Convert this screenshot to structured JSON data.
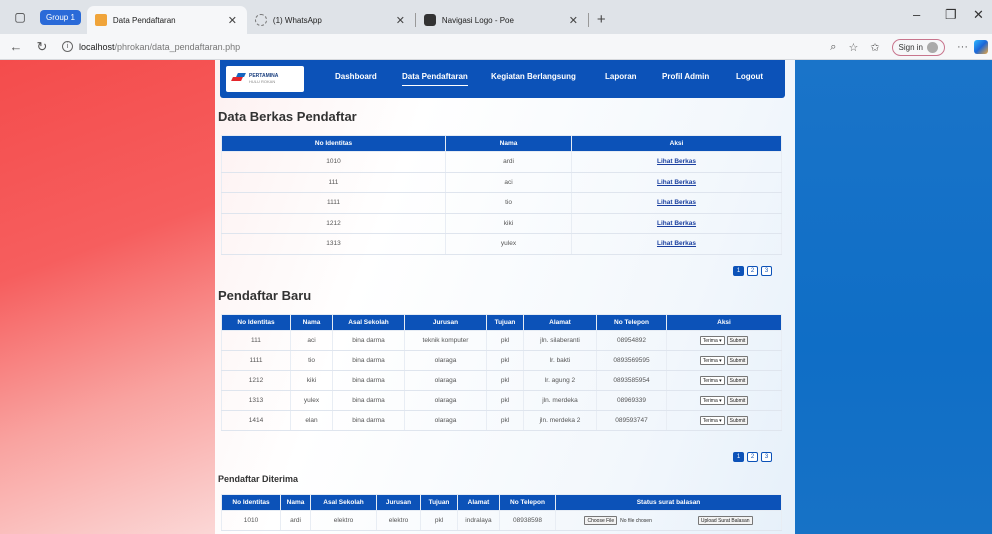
{
  "browser": {
    "group_label": "Group 1",
    "tabs": [
      {
        "title": "Data Pendaftaran",
        "active": true
      },
      {
        "title": "(1) WhatsApp",
        "active": false
      },
      {
        "title": "Navigasi Logo - Poe",
        "active": false
      }
    ],
    "url_host": "localhost",
    "url_path": "/phrokan/data_pendaftaran.php",
    "signin_label": "Sign in"
  },
  "navbar": {
    "logo_text": "PERTAMINA",
    "logo_sub": "HULU ROKAN",
    "items": [
      "Dashboard",
      "Data Pendaftaran",
      "Kegiatan Berlangsung",
      "Laporan",
      "Profil Admin",
      "Logout"
    ],
    "active_index": 1
  },
  "berkas": {
    "title": "Data Berkas Pendaftar",
    "headers": [
      "No Identitas",
      "Nama",
      "Aksi"
    ],
    "rows": [
      {
        "id": "1010",
        "nama": "ardi",
        "aksi": "Lihat Berkas"
      },
      {
        "id": "111",
        "nama": "aci",
        "aksi": "Lihat Berkas"
      },
      {
        "id": "1111",
        "nama": "tio",
        "aksi": "Lihat Berkas"
      },
      {
        "id": "1212",
        "nama": "kiki",
        "aksi": "Lihat Berkas"
      },
      {
        "id": "1313",
        "nama": "yulex",
        "aksi": "Lihat Berkas"
      }
    ],
    "pager": [
      "1",
      "2",
      "3"
    ]
  },
  "baru": {
    "title": "Pendaftar Baru",
    "headers": [
      "No Identitas",
      "Nama",
      "Asal Sekolah",
      "Jurusan",
      "Tujuan",
      "Alamat",
      "No Telepon",
      "Aksi"
    ],
    "rows": [
      {
        "id": "111",
        "nama": "aci",
        "sekolah": "bina darma",
        "jurusan": "teknik komputer",
        "tujuan": "pkl",
        "alamat": "jln. silaberanti",
        "telp": "08954892"
      },
      {
        "id": "1111",
        "nama": "tio",
        "sekolah": "bina darma",
        "jurusan": "olaraga",
        "tujuan": "pkl",
        "alamat": "lr. bakti",
        "telp": "0893569595"
      },
      {
        "id": "1212",
        "nama": "kiki",
        "sekolah": "bina darma",
        "jurusan": "olaraga",
        "tujuan": "pkl",
        "alamat": "lr. agung 2",
        "telp": "0893585954"
      },
      {
        "id": "1313",
        "nama": "yulex",
        "sekolah": "bina darma",
        "jurusan": "olaraga",
        "tujuan": "pkl",
        "alamat": "jln. merdeka",
        "telp": "08969339"
      },
      {
        "id": "1414",
        "nama": "elan",
        "sekolah": "bina darma",
        "jurusan": "olaraga",
        "tujuan": "pkl",
        "alamat": "jln. merdeka 2",
        "telp": "089593747"
      }
    ],
    "select_value": "Terima",
    "submit_label": "Submit",
    "pager": [
      "1",
      "2",
      "3"
    ]
  },
  "diterima": {
    "title": "Pendaftar Diterima",
    "headers": [
      "No Identitas",
      "Nama",
      "Asal Sekolah",
      "Jurusan",
      "Tujuan",
      "Alamat",
      "No Telepon",
      "Status surat balasan"
    ],
    "rows": [
      {
        "id": "1010",
        "nama": "ardi",
        "sekolah": "elektro",
        "jurusan": "elektro",
        "tujuan": "pkl",
        "alamat": "indralaya",
        "telp": "08938598",
        "file_btn": "Choose File",
        "file_text": "No file chosen",
        "upload": "Upload Surat Balasan"
      }
    ]
  }
}
